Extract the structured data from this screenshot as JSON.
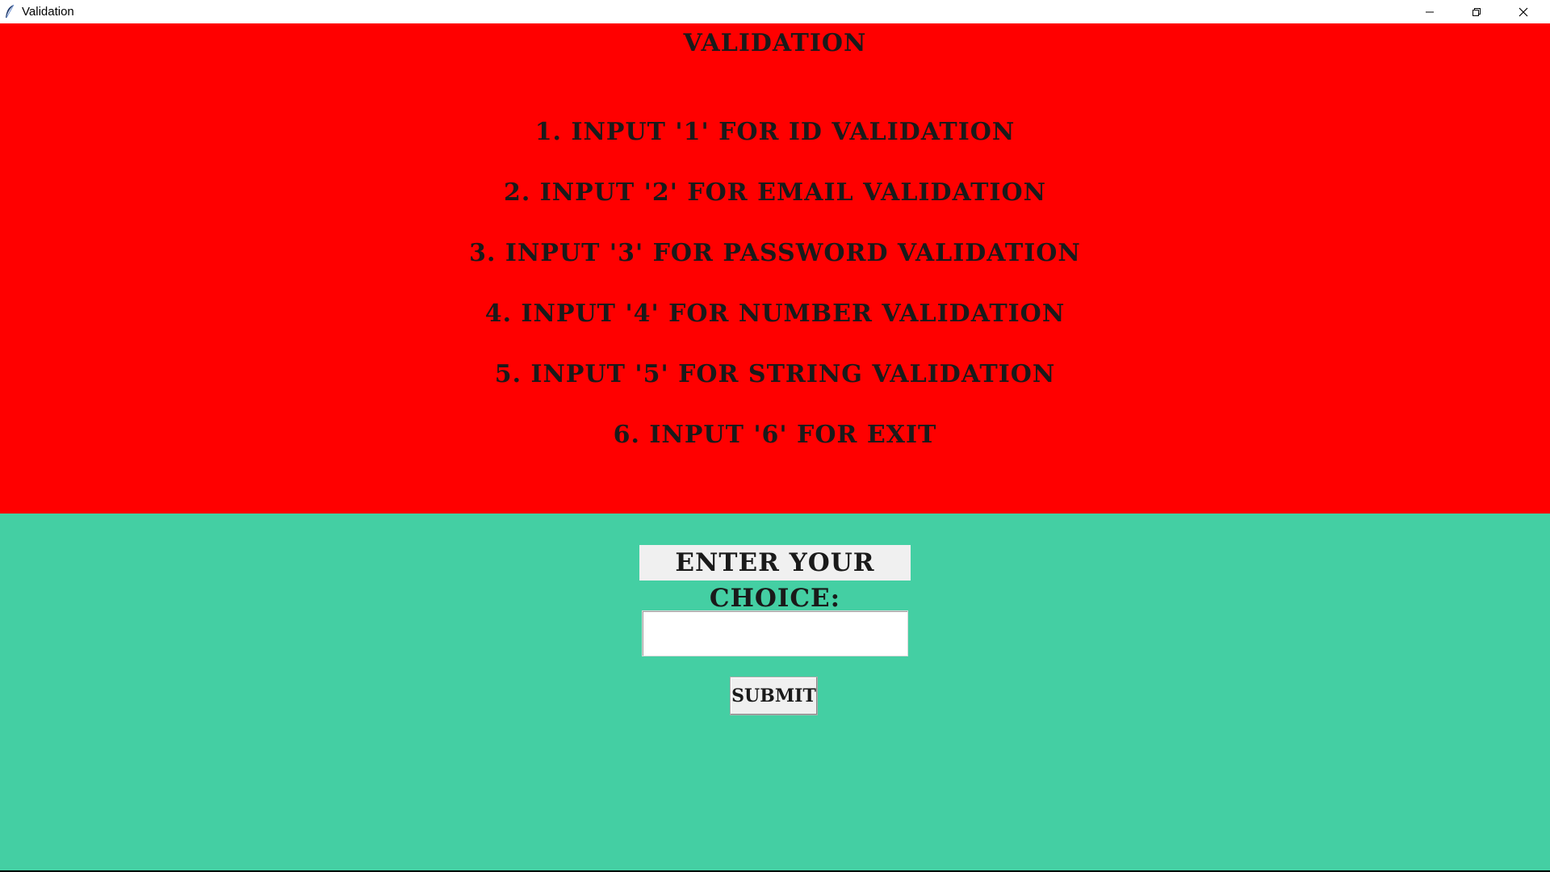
{
  "window": {
    "title": "Validation"
  },
  "heading": "Validation",
  "menu_items": [
    "1. Input '1' for ID validation",
    "2. Input '2' for Email validation",
    "3. Input '3' for Password validation",
    "4. Input '4' for Number validation",
    "5. Input '5' for String validation",
    "6. Input '6' for Exit"
  ],
  "choice": {
    "label": "Enter your choice:",
    "value": ""
  },
  "submit_label": "SUBMIT",
  "colors": {
    "top_panel": "#ff0000",
    "bottom_panel": "#44cfa3",
    "text": "#1a1a1a"
  },
  "icons": {
    "app": "feather-icon",
    "minimize": "minimize-icon",
    "restore": "restore-icon",
    "close": "close-icon"
  }
}
